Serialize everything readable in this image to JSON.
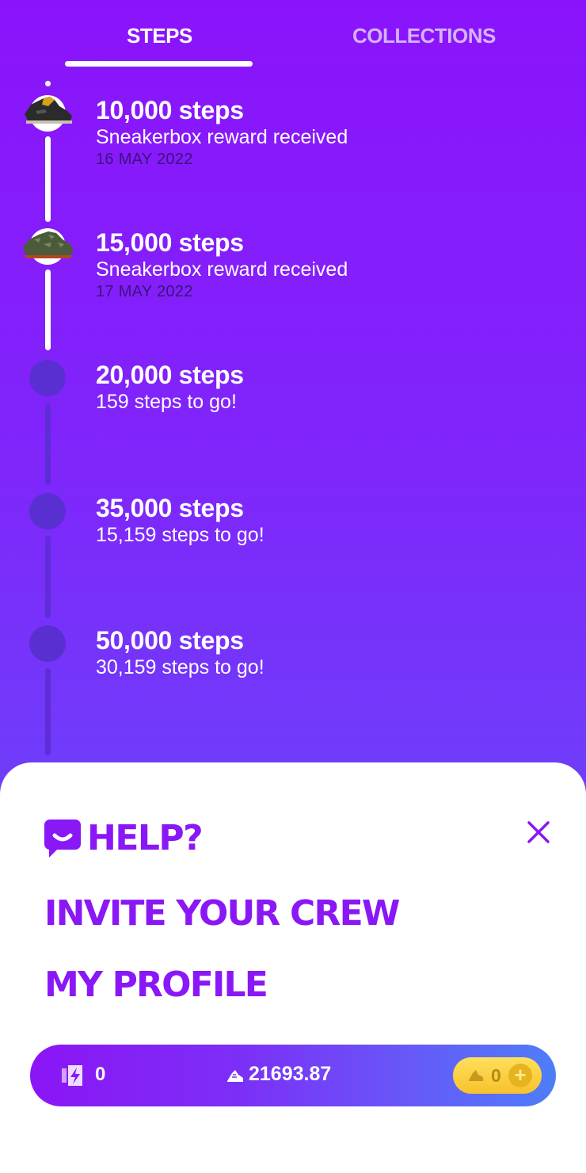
{
  "tabs": {
    "steps": "STEPS",
    "collections": "COLLECTIONS",
    "active": "steps"
  },
  "milestones": [
    {
      "title": "10,000 steps",
      "subtitle": "Sneakerbox reward received",
      "date": "16 MAY 2022",
      "status": "done",
      "icon": "sneaker-black-icon"
    },
    {
      "title": "15,000 steps",
      "subtitle": "Sneakerbox reward received",
      "date": "17 MAY 2022",
      "status": "done",
      "icon": "sneaker-camo-icon"
    },
    {
      "title": "20,000 steps",
      "subtitle": "159 steps to go!",
      "status": "todo"
    },
    {
      "title": "35,000 steps",
      "subtitle": "15,159 steps to go!",
      "status": "todo"
    },
    {
      "title": "50,000 steps",
      "subtitle": "30,159 steps to go!",
      "status": "todo"
    }
  ],
  "menu": {
    "help": "HELP?",
    "invite": "INVITE YOUR CREW",
    "profile": "MY PROFILE",
    "close_icon": "close-icon"
  },
  "balance": {
    "energy": "0",
    "gst": "21693.87",
    "coins": "0"
  },
  "colors": {
    "accent": "#8a17f5",
    "gradient_top": "#8b13fb",
    "gradient_bottom": "#5d56f8",
    "coin": "#f7c22c"
  }
}
